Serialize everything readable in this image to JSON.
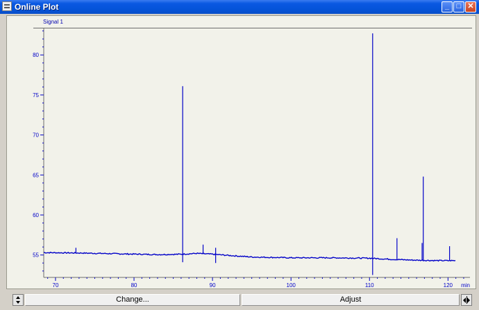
{
  "window": {
    "title": "Online Plot"
  },
  "titlebar_buttons": {
    "minimize": "_",
    "maximize": "□",
    "close": "✕"
  },
  "plot": {
    "signal_label": "Signal 1",
    "x_unit": "min",
    "line_color": "#0000c8"
  },
  "chart_data": {
    "type": "line",
    "title": "",
    "series": [
      {
        "name": "Signal 1",
        "baseline": [
          [
            68.5,
            55.3
          ],
          [
            73,
            55.25
          ],
          [
            78,
            55.15
          ],
          [
            83,
            55.05
          ],
          [
            86,
            55.1
          ],
          [
            88,
            55.2
          ],
          [
            90,
            55.1
          ],
          [
            92,
            54.95
          ],
          [
            95,
            54.75
          ],
          [
            100,
            54.65
          ],
          [
            105,
            54.65
          ],
          [
            110,
            54.6
          ],
          [
            113,
            54.45
          ],
          [
            116,
            54.35
          ],
          [
            119,
            54.3
          ],
          [
            121,
            54.3
          ]
        ],
        "peaks": [
          {
            "x": 72.6,
            "top": 55.9,
            "bottom": 55.25
          },
          {
            "x": 86.2,
            "top": 76.1,
            "bottom": 54.1
          },
          {
            "x": 88.8,
            "top": 56.3,
            "bottom": 55.1
          },
          {
            "x": 90.4,
            "top": 55.9,
            "bottom": 54.0
          },
          {
            "x": 110.4,
            "top": 82.7,
            "bottom": 52.5
          },
          {
            "x": 113.5,
            "top": 57.1,
            "bottom": 54.45
          },
          {
            "x": 116.7,
            "top": 56.5,
            "bottom": 54.35
          },
          {
            "x": 116.85,
            "top": 64.8,
            "bottom": 54.35
          },
          {
            "x": 120.2,
            "top": 56.1,
            "bottom": 54.3
          }
        ]
      }
    ],
    "xlabel": "min",
    "ylabel": "",
    "xlim": [
      68.5,
      122.8
    ],
    "ylim": [
      52.2,
      83.4
    ],
    "xticks": [
      70,
      80,
      90,
      100,
      110,
      120
    ],
    "yticks": [
      55,
      60,
      65,
      70,
      75,
      80
    ],
    "grid": false
  },
  "bottom_bar": {
    "change_label": "Change...",
    "adjust_label": "Adjust"
  }
}
